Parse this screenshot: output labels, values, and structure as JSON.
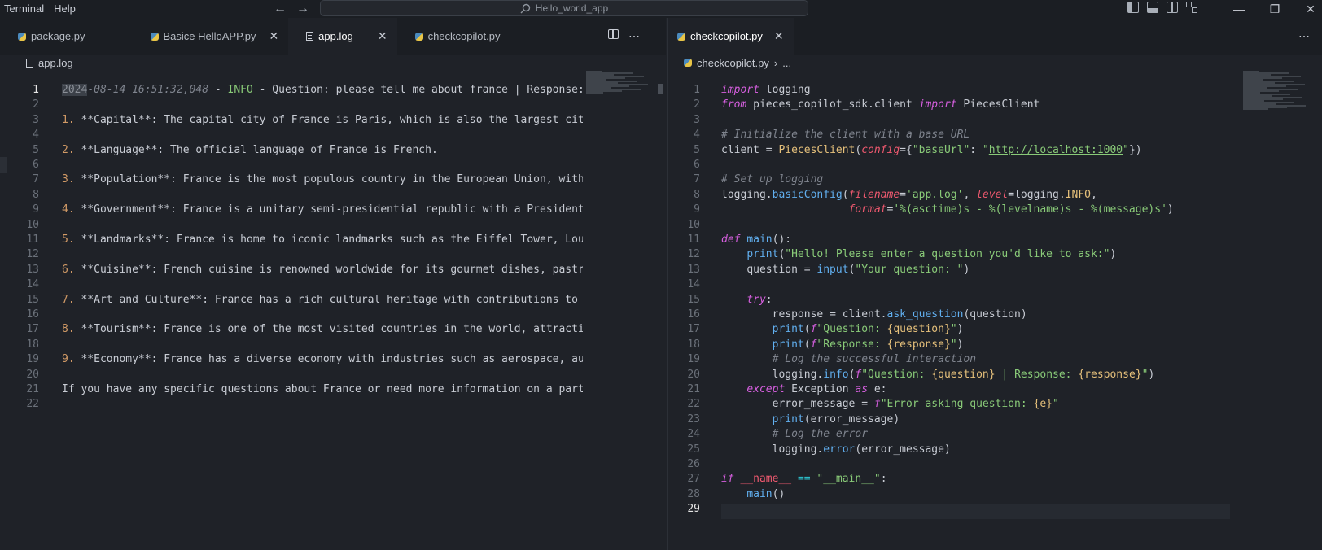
{
  "menu": [
    "Terminal",
    "Help"
  ],
  "search": {
    "text": "Hello_world_app"
  },
  "left_pane": {
    "tabs": [
      {
        "label": "package.py",
        "icon": "python-icon",
        "active": false,
        "closable": false
      },
      {
        "label": "Basice HelloAPP.py",
        "icon": "python-icon",
        "active": false,
        "closable": true
      },
      {
        "label": "app.log",
        "icon": "log-icon",
        "active": true,
        "closable": true
      },
      {
        "label": "checkcopilot.py",
        "icon": "python-icon",
        "active": false,
        "closable": false
      }
    ],
    "breadcrumb": "app.log",
    "lines": [
      "1",
      "2",
      "3",
      "4",
      "5",
      "6",
      "7",
      "8",
      "9",
      "10",
      "11",
      "12",
      "13",
      "14",
      "15",
      "16",
      "17",
      "18",
      "19",
      "20",
      "21",
      "22"
    ],
    "log": {
      "l1_sel": "2024",
      "l1_ts": "-08-14 16:51:32,048",
      "l1_sep1": " - ",
      "l1_level": "INFO",
      "l1_rest": " - Question: please tell me about france | Response:",
      "l3_num": "1.",
      "l3": " **Capital**: The capital city of France is Paris, which is also the largest city",
      "l5_num": "2.",
      "l5": " **Language**: The official language of France is French.",
      "l7_num": "3.",
      "l7": " **Population**: France is the most populous country in the European Union, with",
      "l9_num": "4.",
      "l9": " **Government**: France is a unitary semi-presidential republic with a President",
      "l11_num": "5.",
      "l11": " **Landmarks**: France is home to iconic landmarks such as the Eiffel Tower, Louv",
      "l13_num": "6.",
      "l13": " **Cuisine**: French cuisine is renowned worldwide for its gourmet dishes, pastri",
      "l15_num": "7.",
      "l15": " **Art and Culture**: France has a rich cultural heritage with contributions to a",
      "l17_num": "8.",
      "l17": " **Tourism**: France is one of the most visited countries in the world, attractin",
      "l19_num": "9.",
      "l19": " **Economy**: France has a diverse economy with industries such as aerospace, aut",
      "l21": "If you have any specific questions about France or need more information on a parti"
    }
  },
  "right_pane": {
    "tabs": [
      {
        "label": "checkcopilot.py",
        "icon": "python-icon",
        "active": true,
        "closable": true
      }
    ],
    "breadcrumb": "checkcopilot.py",
    "breadcrumb_more": "...",
    "code": {
      "l1_kw": "import",
      "l1_rest": " logging",
      "l2_kw1": "from",
      "l2_mid": " pieces_copilot_sdk.client ",
      "l2_kw2": "import",
      "l2_rest": " PiecesClient",
      "l4": "# Initialize the client with a base URL",
      "l5_a": "client = ",
      "l5_cls": "PiecesClient",
      "l5_b": "(",
      "l5_param": "config",
      "l5_c": "={",
      "l5_key": "\"baseUrl\"",
      "l5_d": ": ",
      "l5_q1": "\"",
      "l5_url": "http://localhost:1000",
      "l5_q2": "\"",
      "l5_e": "})",
      "l7": "# Set up logging",
      "l8_a": "logging.",
      "l8_fn": "basicConfig",
      "l8_b": "(",
      "l8_p1": "filename",
      "l8_c": "=",
      "l8_s1": "'app.log'",
      "l8_d": ", ",
      "l8_p2": "level",
      "l8_e": "=logging.",
      "l8_info": "INFO",
      "l8_f": ",",
      "l9_p": "format",
      "l9_a": "=",
      "l9_s": "'%(asctime)s - %(levelname)s - %(message)s'",
      "l9_b": ")",
      "l11_kw": "def",
      "l11_fn": "main",
      "l11_rest": "():",
      "l12_fn": "print",
      "l12_a": "(",
      "l12_s": "\"Hello! Please enter a question you'd like to ask:\"",
      "l12_b": ")",
      "l13_a": "question = ",
      "l13_fn": "input",
      "l13_b": "(",
      "l13_s": "\"Your question: \"",
      "l13_c": ")",
      "l15_kw": "try",
      "l15_rest": ":",
      "l16_a": "response = client.",
      "l16_fn": "ask_question",
      "l16_b": "(question)",
      "l17_fn": "print",
      "l17_a": "(",
      "l17_f": "f",
      "l17_s1": "\"Question: ",
      "l17_v": "{question}",
      "l17_s2": "\"",
      "l17_b": ")",
      "l18_fn": "print",
      "l18_a": "(",
      "l18_f": "f",
      "l18_s1": "\"Response: ",
      "l18_v": "{response}",
      "l18_s2": "\"",
      "l18_b": ")",
      "l19": "# Log the successful interaction",
      "l20_a": "logging.",
      "l20_fn": "info",
      "l20_b": "(",
      "l20_f": "f",
      "l20_s1": "\"Question: ",
      "l20_v1": "{question}",
      "l20_s2": " | Response: ",
      "l20_v2": "{response}",
      "l20_s3": "\"",
      "l20_c": ")",
      "l21_kw": "except",
      "l21_a": " Exception ",
      "l21_kw2": "as",
      "l21_b": " e:",
      "l22_a": "error_message = ",
      "l22_f": "f",
      "l22_s1": "\"Error asking question: ",
      "l22_v": "{e}",
      "l22_s2": "\"",
      "l23_fn": "print",
      "l23_a": "(error_message)",
      "l24": "# Log the error",
      "l25_a": "logging.",
      "l25_fn": "error",
      "l25_b": "(error_message)",
      "l27_kw": "if",
      "l27_a": " ",
      "l27_d": "__name__",
      "l27_b": " ",
      "l27_op": "==",
      "l27_c": " ",
      "l27_s": "\"__main__\"",
      "l27_e": ":",
      "l28_fn": "main",
      "l28_a": "()"
    },
    "lines": [
      "1",
      "2",
      "3",
      "4",
      "5",
      "6",
      "7",
      "8",
      "9",
      "10",
      "11",
      "12",
      "13",
      "14",
      "15",
      "16",
      "17",
      "18",
      "19",
      "20",
      "21",
      "22",
      "23",
      "24",
      "25",
      "26",
      "27",
      "28",
      "29"
    ]
  }
}
